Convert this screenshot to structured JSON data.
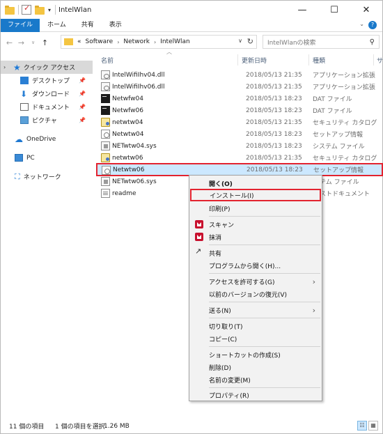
{
  "window": {
    "title": "IntelWlan",
    "controls": [
      "—",
      "☐",
      "✕"
    ]
  },
  "ribbon": {
    "tabs": [
      "ファイル",
      "ホーム",
      "共有",
      "表示"
    ]
  },
  "address": {
    "overflow": "«",
    "crumbs": [
      "Software",
      "Network",
      "IntelWlan"
    ],
    "search_placeholder": "IntelWlanの検索"
  },
  "nav": {
    "quick_access": "クイック アクセス",
    "desktop": "デスクトップ",
    "downloads": "ダウンロード",
    "documents": "ドキュメント",
    "pictures": "ピクチャ",
    "onedrive": "OneDrive",
    "pc": "PC",
    "network": "ネットワーク"
  },
  "columns": {
    "name": "名前",
    "date": "更新日時",
    "type": "種類",
    "size": "サ"
  },
  "files": [
    {
      "name": "IntelWifiIhv04.dll",
      "date": "2018/05/13 21:35",
      "type": "アプリケーション拡張",
      "icon": "dll-icon"
    },
    {
      "name": "IntelWifiIhv06.dll",
      "date": "2018/05/13 21:35",
      "type": "アプリケーション拡張",
      "icon": "dll-icon"
    },
    {
      "name": "Netwfw04",
      "date": "2018/05/13 18:23",
      "type": "DAT ファイル",
      "icon": "dat-icon"
    },
    {
      "name": "Netwfw06",
      "date": "2018/05/13 18:23",
      "type": "DAT ファイル",
      "icon": "dat-icon"
    },
    {
      "name": "netwtw04",
      "date": "2018/05/13 21:35",
      "type": "セキュリティ カタログ",
      "icon": "catalog-icon"
    },
    {
      "name": "Netwtw04",
      "date": "2018/05/13 18:23",
      "type": "セットアップ情報",
      "icon": "inf-icon"
    },
    {
      "name": "NETwtw04.sys",
      "date": "2018/05/13 18:23",
      "type": "システム ファイル",
      "icon": "sys-icon"
    },
    {
      "name": "netwtw06",
      "date": "2018/05/13 21:35",
      "type": "セキュリティ カタログ",
      "icon": "catalog-icon"
    },
    {
      "name": "Netwtw06",
      "date": "2018/05/13 18:23",
      "type": "セットアップ情報",
      "icon": "inf-icon"
    },
    {
      "name": "NETwtw06.sys",
      "date": "",
      "type": "テム ファイル",
      "icon": "sys-icon"
    },
    {
      "name": "readme",
      "date": "",
      "type": "ストドキュメント",
      "icon": "text-icon"
    }
  ],
  "selected_index": 8,
  "context_menu": {
    "open": "開く(O)",
    "install": "インストール(I)",
    "print": "印刷(P)",
    "scan": "スキャン",
    "erase": "抹消",
    "share": "共有",
    "open_with": "プログラムから開く(H)...",
    "give_access": "アクセスを許可する(G)",
    "restore": "以前のバージョンの復元(V)",
    "send_to": "送る(N)",
    "cut": "切り取り(T)",
    "copy": "コピー(C)",
    "create_shortcut": "ショートカットの作成(S)",
    "delete": "削除(D)",
    "rename": "名前の変更(M)",
    "properties": "プロパティ(R)"
  },
  "status": {
    "count": "11 個の項目",
    "selected": "1 個の項目を選択",
    "size": "1.26 MB"
  },
  "colors": {
    "accent": "#1979ca",
    "selection": "#cce8ff",
    "highlight_box": "#e3232f"
  }
}
